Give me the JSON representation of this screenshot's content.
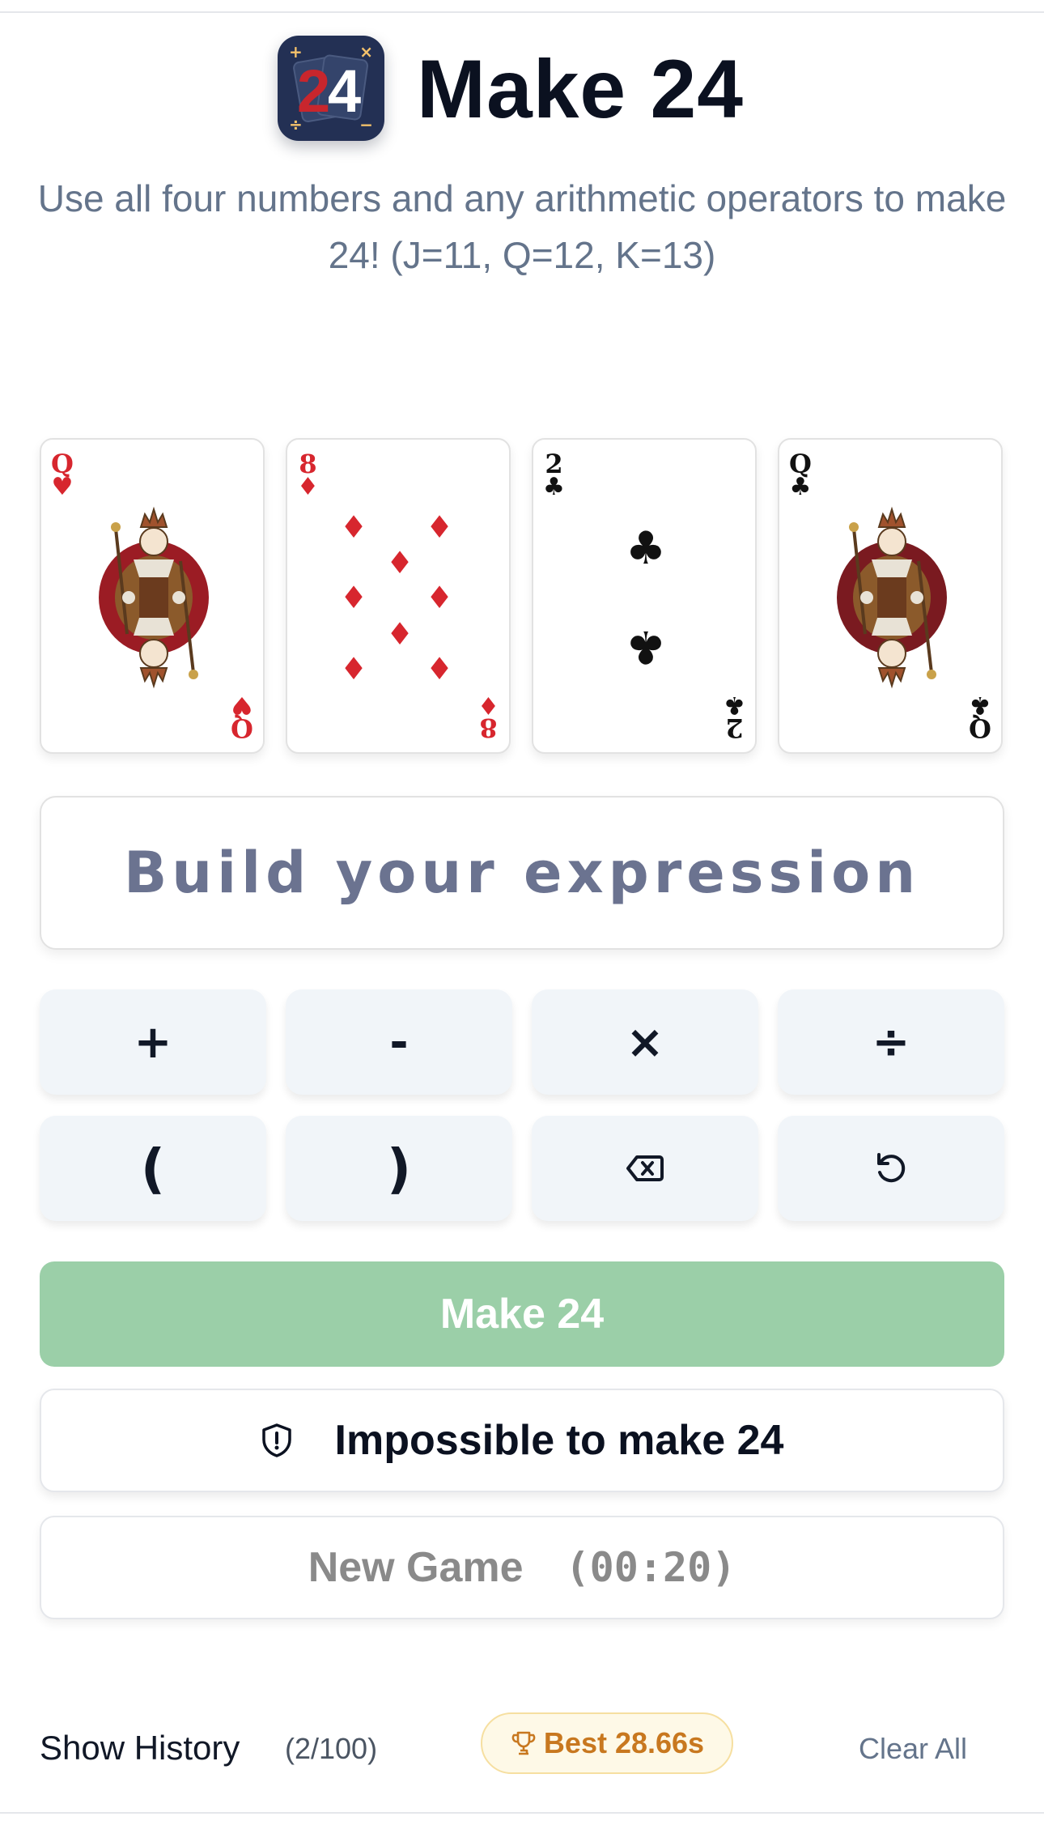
{
  "app": {
    "title": "Make 24",
    "subtitle": "Use all four numbers and any arithmetic operators to make 24! (J=11, Q=12, K=13)",
    "icon": {
      "name": "app-logo-icon",
      "number": "24",
      "corner_symbols": [
        "+",
        "×",
        "÷",
        "−"
      ]
    }
  },
  "cards": [
    {
      "rank": "Q",
      "suit": "♥",
      "color": "#d7262e",
      "type": "court"
    },
    {
      "rank": "8",
      "suit": "♦",
      "color": "#d7262e",
      "type": "pips"
    },
    {
      "rank": "2",
      "suit": "♣",
      "color": "#111111",
      "type": "pips"
    },
    {
      "rank": "Q",
      "suit": "♣",
      "color": "#111111",
      "type": "court"
    }
  ],
  "expression": {
    "placeholder": "Build your expression"
  },
  "operators": [
    {
      "label": "+",
      "name": "plus-button"
    },
    {
      "label": "-",
      "name": "minus-button"
    },
    {
      "label": "×",
      "name": "multiply-button"
    },
    {
      "label": "÷",
      "name": "divide-button"
    },
    {
      "label": "(",
      "name": "open-paren-button"
    },
    {
      "label": ")",
      "name": "close-paren-button"
    },
    {
      "icon": "backspace-icon",
      "name": "backspace-button"
    },
    {
      "icon": "reset-icon",
      "name": "reset-button"
    }
  ],
  "buttons": {
    "make": "Make 24",
    "impossible": "Impossible to make 24",
    "new_game": "New Game",
    "timer": "(00:20)"
  },
  "footer": {
    "show_history": "Show History",
    "history_count": "(2/100)",
    "best": "Best 28.66s",
    "clear_all": "Clear All"
  },
  "colors": {
    "make_button": "#9bcfa8",
    "best_badge": "#fef9e7",
    "best_text": "#c8781f",
    "op_button": "#f1f5f9"
  }
}
